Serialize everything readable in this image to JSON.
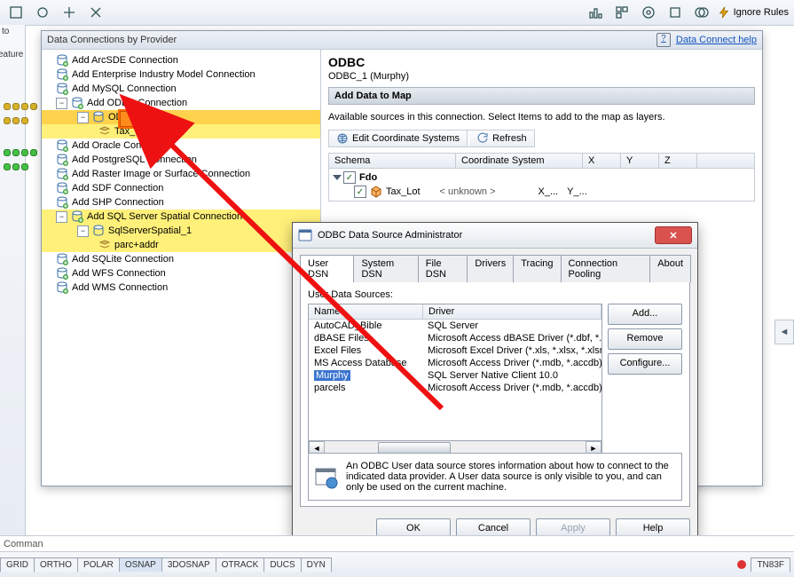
{
  "toolbar": {
    "ignore_rules": "Ignore Rules"
  },
  "left_misc": {
    "to": "to",
    "eature": "eature"
  },
  "panel": {
    "title": "Data Connections by Provider",
    "help_link": "Data Connect help",
    "tree": {
      "items": [
        {
          "label": "Add ArcSDE Connection"
        },
        {
          "label": "Add Enterprise Industry Model Connection"
        },
        {
          "label": "Add MySQL Connection"
        },
        {
          "label": "Add ODBC Connection"
        },
        {
          "label": "Add Oracle Connection"
        },
        {
          "label": "Add PostgreSQL Connection"
        },
        {
          "label": "Add Raster Image or Surface Connection"
        },
        {
          "label": "Add SDF Connection"
        },
        {
          "label": "Add SHP Connection"
        },
        {
          "label": "Add SQL Server Spatial Connection"
        },
        {
          "label": "Add SQLite Connection"
        },
        {
          "label": "Add WFS Connection"
        },
        {
          "label": "Add WMS Connection"
        }
      ],
      "odbc_node": "ODBC_1",
      "odbc_child": "Tax_Lot",
      "sql_node": "SqlServerSpatial_1",
      "sql_child": "parc+addr"
    },
    "detail": {
      "heading": "ODBC",
      "sub": "ODBC_1 (Murphy)",
      "band": "Add Data to Map",
      "avail": "Available sources in this connection.  Select Items to add to the map as layers.",
      "btn_edit": "Edit Coordinate Systems",
      "btn_refresh": "Refresh",
      "cols": {
        "schema": "Schema",
        "cs": "Coordinate System",
        "x": "X",
        "y": "Y",
        "z": "Z"
      },
      "fdo": "Fdo",
      "row_item": "Tax_Lot",
      "row_cs": "< unknown >",
      "row_x": "X_...",
      "row_y": "Y_..."
    }
  },
  "odbc": {
    "title": "ODBC Data Source Administrator",
    "tabs": [
      "User DSN",
      "System DSN",
      "File DSN",
      "Drivers",
      "Tracing",
      "Connection Pooling",
      "About"
    ],
    "uds_label": "User Data Sources:",
    "cols": {
      "name": "Name",
      "driver": "Driver"
    },
    "rows": [
      {
        "name": "AutoCAD_Bible",
        "driver": "SQL Server"
      },
      {
        "name": "dBASE Files",
        "driver": "Microsoft Access dBASE Driver (*.dbf, *.ndx"
      },
      {
        "name": "Excel Files",
        "driver": "Microsoft Excel Driver (*.xls, *.xlsx, *.xlsm, *.x"
      },
      {
        "name": "MS Access Database",
        "driver": "Microsoft Access Driver (*.mdb, *.accdb)"
      },
      {
        "name": "Murphy",
        "driver": "SQL Server Native Client 10.0"
      },
      {
        "name": "parcels",
        "driver": "Microsoft Access Driver (*.mdb, *.accdb)"
      }
    ],
    "selected_index": 4,
    "side": {
      "add": "Add...",
      "remove": "Remove",
      "config": "Configure..."
    },
    "info": "An ODBC User data source stores information about how to connect to the indicated data provider.  A User data source is only visible to you, and can only be used on the current machine.",
    "foot": {
      "ok": "OK",
      "cancel": "Cancel",
      "apply": "Apply",
      "help": "Help"
    }
  },
  "status": {
    "tabs": [
      "GRID",
      "ORTHO",
      "POLAR",
      "OSNAP",
      "3DOSNAP",
      "OTRACK",
      "DUCS",
      "DYN"
    ],
    "right": "TN83F"
  },
  "cmd": "Comman"
}
